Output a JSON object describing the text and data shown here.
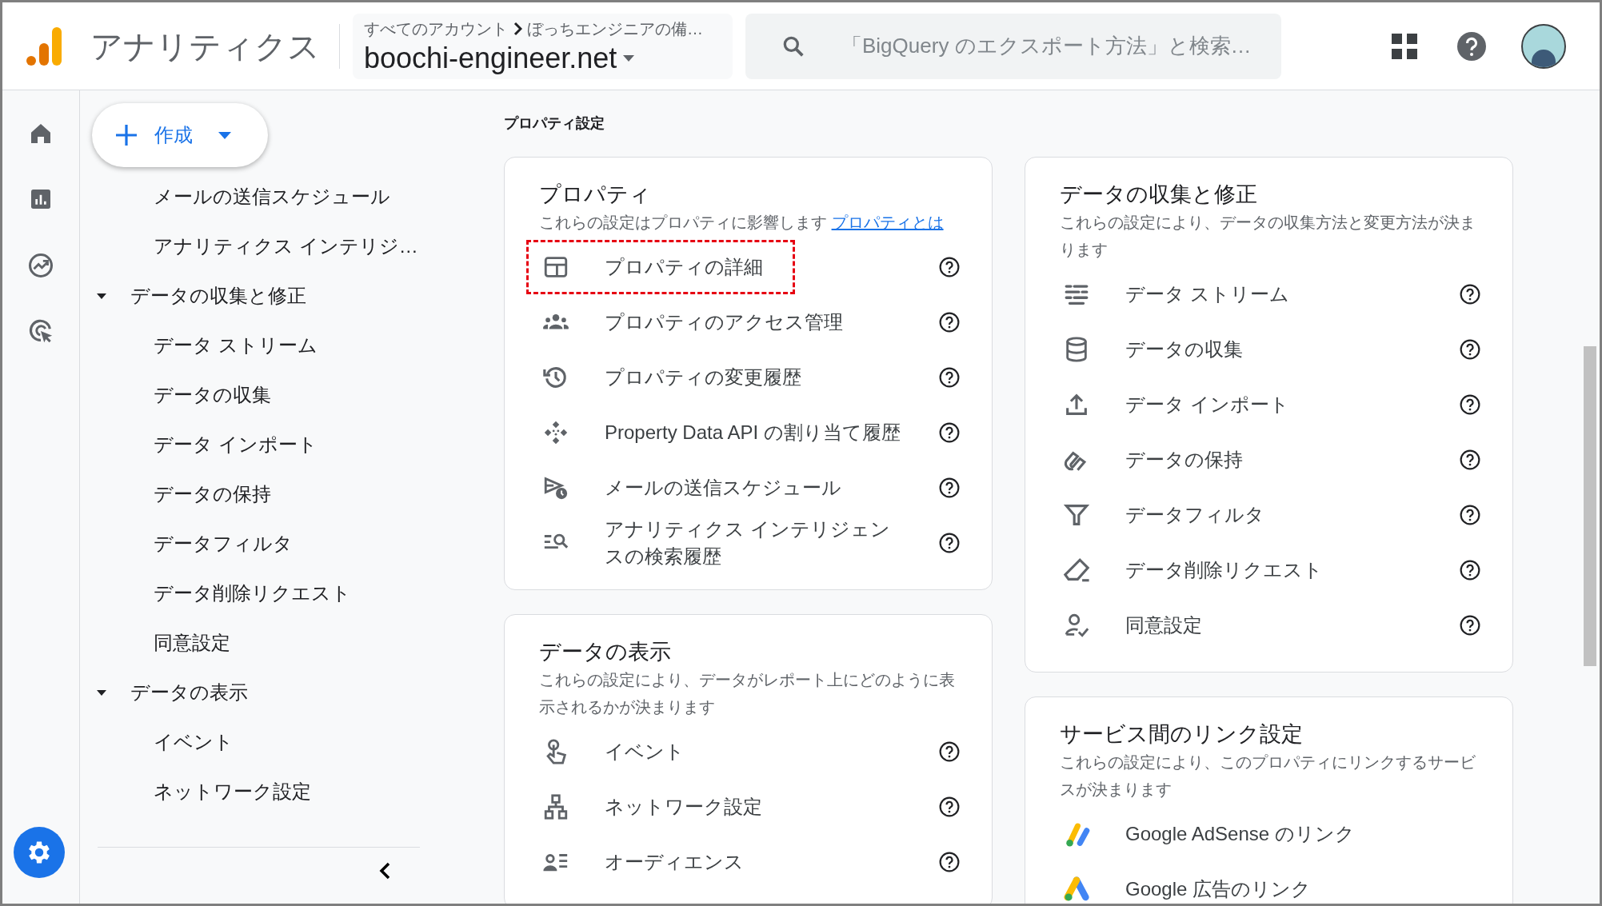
{
  "header": {
    "app_title": "アナリティクス",
    "breadcrumb_root": "すべてのアカウント",
    "breadcrumb_account": "ぼっちエンジニアの備…",
    "property_name": "boochi-engineer.net",
    "search": {
      "placeholder": "「BigQuery のエクスポート方法」と検索…"
    }
  },
  "create_button": {
    "label": "作成"
  },
  "nav": [
    {
      "label": "メールの送信スケジュール"
    },
    {
      "label": "アナリティクス インテリジ…"
    },
    {
      "label": "データの収集と修正",
      "expanded": true,
      "children": [
        {
          "label": "データ ストリーム"
        },
        {
          "label": "データの収集"
        },
        {
          "label": "データ インポート"
        },
        {
          "label": "データの保持"
        },
        {
          "label": "データフィルタ"
        },
        {
          "label": "データ削除リクエスト"
        },
        {
          "label": "同意設定"
        }
      ]
    },
    {
      "label": "データの表示",
      "expanded": true,
      "children": [
        {
          "label": "イベント"
        },
        {
          "label": "ネットワーク設定"
        }
      ]
    }
  ],
  "page_title": "プロパティ設定",
  "left_cards": [
    {
      "kind": "settings",
      "title": "プロパティ",
      "description": "これらの設定はプロパティに影響します",
      "link": "プロパティとは",
      "items": [
        {
          "label": "プロパティの詳細",
          "highlighted": true
        },
        {
          "label": "プロパティのアクセス管理",
          "highlighted": false
        },
        {
          "label": "プロパティの変更履歴",
          "highlighted": false
        },
        {
          "label": "Property Data API の割り当て履歴",
          "highlighted": false
        },
        {
          "label": "メールの送信スケジュール",
          "highlighted": false
        },
        {
          "label": "アナリティクス インテリジェンスの検索履歴",
          "highlighted": false
        }
      ]
    },
    {
      "kind": "settings",
      "title": "データの表示",
      "description": "これらの設定により、データがレポート上にどのように表示されるかが決まります",
      "items": [
        {
          "label": "イベント",
          "highlighted": false
        },
        {
          "label": "ネットワーク設定",
          "highlighted": false
        },
        {
          "label": "オーディエンス",
          "highlighted": false
        }
      ]
    }
  ],
  "right_cards": [
    {
      "kind": "settings",
      "title": "データの収集と修正",
      "description": "これらの設定により、データの収集方法と変更方法が決まります",
      "items": [
        {
          "label": "データ ストリーム",
          "highlighted": false
        },
        {
          "label": "データの収集",
          "highlighted": false
        },
        {
          "label": "データ インポート",
          "highlighted": false
        },
        {
          "label": "データの保持",
          "highlighted": false
        },
        {
          "label": "データフィルタ",
          "highlighted": false
        },
        {
          "label": "データ削除リクエスト",
          "highlighted": false
        },
        {
          "label": "同意設定",
          "highlighted": false
        }
      ]
    },
    {
      "kind": "links",
      "title": "サービス間のリンク設定",
      "description": "これらの設定により、このプロパティにリンクするサービスが決まります",
      "items": [
        {
          "label": "Google AdSense のリンク",
          "highlighted": false
        },
        {
          "label": "Google 広告のリンク",
          "highlighted": false
        }
      ]
    }
  ]
}
